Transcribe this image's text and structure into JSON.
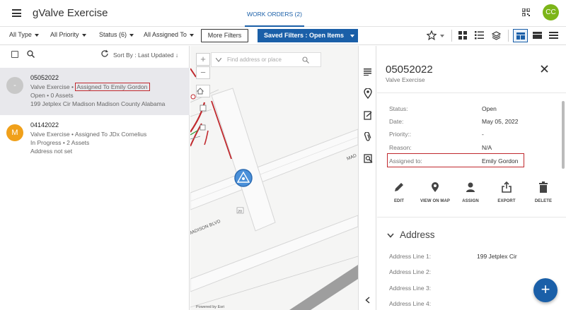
{
  "app": {
    "title": "gValve Exercise",
    "active_tab": "WORK ORDERS (2)",
    "user_initials": "CC",
    "colors": {
      "accent": "#1a5fa8",
      "avatar": "#7cb518",
      "highlight": "#c0282d"
    }
  },
  "filters": {
    "type": "All Type",
    "priority": "All Priority",
    "status": "Status (6)",
    "assigned": "All Assigned To",
    "more": "More Filters",
    "saved": "Saved Filters : Open Items"
  },
  "list": {
    "sort_label": "Sort By : Last Updated",
    "items": [
      {
        "avatar": "-",
        "avatar_color": "#c8c8c8",
        "id": "05052022",
        "asset": "Valve Exercise •",
        "assigned": "Assigned To Emily Gordon",
        "status": "Open • 0 Assets",
        "address": "199 Jetplex Cir Madison Madison County Alabama"
      },
      {
        "avatar": "M",
        "avatar_color": "#f0a01a",
        "id": "04142022",
        "asset": "Valve Exercise •",
        "assigned": "Assigned To JDx Cornelius",
        "status": "In Progress • 2 Assets",
        "address": "Address not set"
      }
    ]
  },
  "map": {
    "search_placeholder": "Find address or place",
    "credit": "Powered by Esri",
    "street_labels": [
      "MADISON BLVD",
      "MAD",
      "20"
    ]
  },
  "detail": {
    "title": "05052022",
    "subtitle": "Valve Exercise",
    "fields": [
      {
        "label": "Status:",
        "value": "Open"
      },
      {
        "label": "Date:",
        "value": "May 05, 2022"
      },
      {
        "label": "Priority::",
        "value": "-"
      },
      {
        "label": "Reason:",
        "value": "N/A"
      },
      {
        "label": "Assigned to:",
        "value": "Emily Gordon"
      }
    ],
    "actions": [
      "EDIT",
      "VIEW ON MAP",
      "ASSIGN",
      "EXPORT",
      "DELETE"
    ],
    "address_section": "Address",
    "address_lines": [
      {
        "label": "Address Line 1:",
        "value": "199 Jetplex Cir"
      },
      {
        "label": "Address Line 2:",
        "value": ""
      },
      {
        "label": "Address Line 3:",
        "value": ""
      },
      {
        "label": "Address Line 4:",
        "value": ""
      }
    ]
  }
}
